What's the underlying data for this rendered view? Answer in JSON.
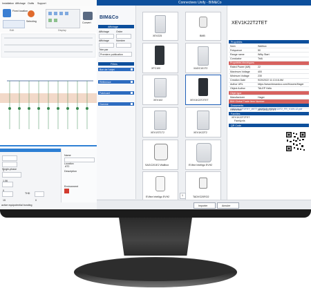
{
  "left_app": {
    "menu": [
      "Installation",
      "Affichage",
      "Outils",
      "Support"
    ],
    "toolbar": [
      "Fixed location",
      "Selecting",
      "Convert"
    ],
    "ribbon_groups": [
      "Edit",
      "Display",
      "Tools"
    ],
    "lower": {
      "inputs": [
        "1",
        "1",
        "Single-phase",
        "1.06",
        "0",
        "15",
        "THD",
        "0"
      ],
      "props": [
        "Name",
        "AT2",
        "Location",
        "Description",
        "Environment"
      ],
      "footer": "active equipotential bonding"
    }
  },
  "dialog": {
    "title": "Connectees Unify - BIM&Co",
    "brand": "BIM&Co",
    "sections": {
      "affichage": "Affichage",
      "filtres": "Filtres"
    },
    "affichage": {
      "labels": [
        "Affichage",
        "Ordre",
        "Affichage",
        "Nombre",
        "Trier par"
      ],
      "sort_value": "Premiere publication"
    },
    "filters": [
      {
        "label": "Bon de l'objet"
      },
      {
        "label": "Référence"
      },
      {
        "label": "Fabricant"
      },
      {
        "label": "Gamme"
      }
    ],
    "products": [
      {
        "name": "XEV225"
      },
      {
        "name": "BMB"
      },
      {
        "name": "XFC100"
      },
      {
        "name": "XAGC101T2"
      },
      {
        "name": "XEV102"
      },
      {
        "name": "XEV1K22T2TET"
      },
      {
        "name": "XEV1ST1T2"
      },
      {
        "name": "XEV1K22T2"
      },
      {
        "name": "SAGC201E2 Wallbox"
      },
      {
        "name": "EVline Intelligo EVH2"
      },
      {
        "name": "EVline Intelligo EVH2"
      },
      {
        "name": "TADVG20RO2"
      }
    ],
    "selected_title": "XEV1K22T2TET",
    "properties_header": "Propriétés",
    "properties": [
      {
        "k": "Nom",
        "v": "Wallbox",
        "cat": false
      },
      {
        "k": "Fréquence",
        "v": "50",
        "cat": false
      },
      {
        "k": "Range name",
        "v": "Witty Start",
        "cat": false
      },
      {
        "k": "Conductor",
        "v": "TriAi",
        "cat": false
      },
      {
        "k": "Propriétés électriques",
        "v": "",
        "cat": true
      },
      {
        "k": "Rated Power (kW)",
        "v": "22",
        "cat": false
      },
      {
        "k": "Maximum Voltage",
        "v": "400",
        "cat": false
      },
      {
        "k": "Minimum Voltage",
        "v": "230",
        "cat": false
      },
      {
        "k": "Creation Date",
        "v": "9/20/2022 11:13:16 AM",
        "cat": false
      },
      {
        "k": "Author URL",
        "v": "https://www.bimandco.com/fr/users/Hager",
        "cat": false
      },
      {
        "k": "Object Author",
        "v": "TALEP Hello",
        "cat": false
      },
      {
        "k": "Objet type",
        "v": "",
        "cat": true
      },
      {
        "k": "Manufacturer",
        "v": "Hager",
        "cat": false
      },
      {
        "k": "BIM Global Trade Item Number",
        "v": "",
        "cat": true
      },
      {
        "k": "Reference description",
        "v": "Witty borne de charge IP55 1x22kW 3P T2+T2 RFID",
        "cat": false
      },
      {
        "k": "Reference",
        "v": "XEV1K22T2TET",
        "cat": false
      }
    ],
    "documents_header": "Documents",
    "documents": [
      "XEV1K22T2TET_WITT_BORNE_XEV1K22T2_FR_V109-12.pdf"
    ],
    "families_header": "Familles",
    "families": [
      "XEV1K22T2TET",
      "Family.rfa"
    ],
    "qr_header": "QR Code",
    "page_number": "1",
    "buttons": {
      "import": "Importer",
      "cancel": "Annuler"
    }
  }
}
